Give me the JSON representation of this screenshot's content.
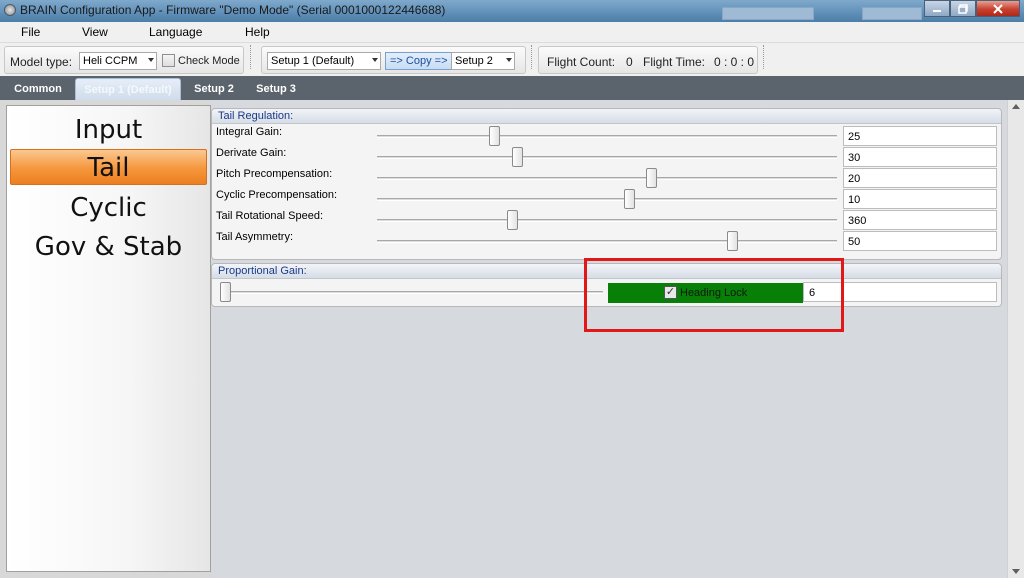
{
  "window": {
    "title": "BRAIN Configuration App - Firmware \"Demo Mode\" (Serial 0001000122446688)"
  },
  "menu": {
    "items": [
      "File",
      "View",
      "Language",
      "Help"
    ]
  },
  "toolbar": {
    "model_type_label": "Model type:",
    "model_type_value": "Heli CCPM",
    "check_mode_label": "Check Mode",
    "setup_from": "Setup 1 (Default)",
    "copy_label": "=> Copy =>",
    "setup_to": "Setup 2",
    "flight_count_label": "Flight Count:",
    "flight_count_value": "0",
    "flight_time_label": "Flight Time:",
    "flight_time_value": "0 : 0 : 0"
  },
  "tabs": [
    {
      "label": "Common",
      "active": false
    },
    {
      "label": "Setup 1 (Default)",
      "active": true
    },
    {
      "label": "Setup 2",
      "active": false
    },
    {
      "label": "Setup 3",
      "active": false
    }
  ],
  "nav": {
    "items": [
      {
        "label": "Input",
        "active": false
      },
      {
        "label": "Tail",
        "active": true
      },
      {
        "label": "Cyclic",
        "active": false
      },
      {
        "label": "Gov & Stab",
        "active": false
      }
    ],
    "active_color": "#f5963c"
  },
  "tail_regulation": {
    "title": "Tail Regulation:",
    "params": [
      {
        "label": "Integral Gain:",
        "value": "25",
        "slider_fraction": 0.25
      },
      {
        "label": "Derivate Gain:",
        "value": "30",
        "slider_fraction": 0.3
      },
      {
        "label": "Pitch Precompensation:",
        "value": "20",
        "slider_fraction": 0.6
      },
      {
        "label": "Cyclic Precompensation:",
        "value": "10",
        "slider_fraction": 0.55
      },
      {
        "label": "Tail Rotational Speed:",
        "value": "360",
        "slider_fraction": 0.29
      },
      {
        "label": "Tail Asymmetry:",
        "value": "50",
        "slider_fraction": 0.78
      }
    ]
  },
  "proportional_gain": {
    "title": "Proportional Gain:",
    "slider_fraction": 0.0,
    "heading_lock_label": "Heading Lock",
    "heading_lock_checked": true,
    "heading_lock_color": "#088008",
    "value": "6",
    "check_glyph": "✓"
  }
}
